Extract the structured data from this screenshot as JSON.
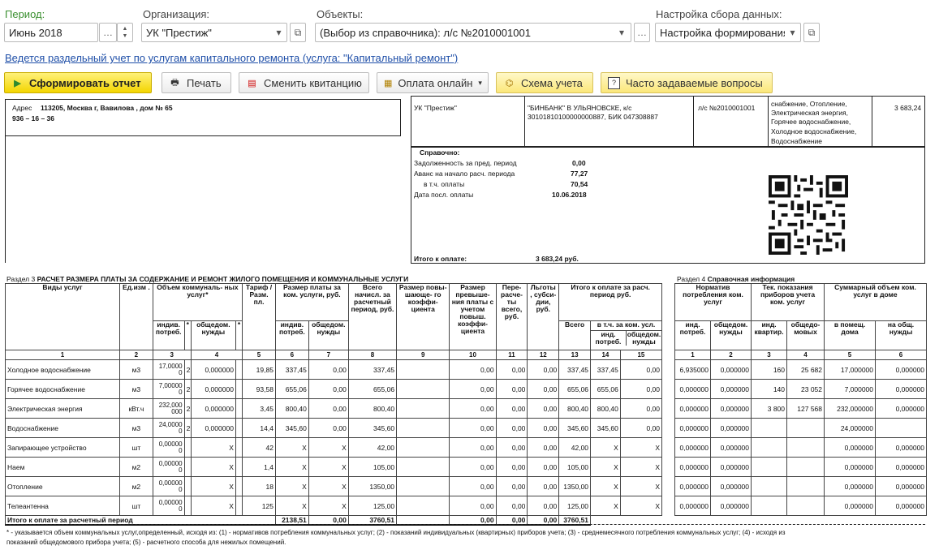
{
  "filters": {
    "period_label": "Период:",
    "period_value": "Июнь 2018",
    "org_label": "Организация:",
    "org_value": "УК \"Престиж\"",
    "objects_label": "Объекты:",
    "objects_value": "(Выбор из справочника): л/с №2010001001",
    "settings_label": "Настройка сбора данных:",
    "settings_value": "Настройка формирования"
  },
  "info_link": "Ведется раздельный учет по услугам капитального ремонта (услуга: \"Капитальный ремонт\")",
  "toolbar": {
    "generate": "Сформировать отчет",
    "print": "Печать",
    "change": "Сменить квитанцию",
    "pay": "Оплата онлайн",
    "scheme": "Схема учета",
    "faq": "Часто задаваемые вопросы"
  },
  "receipt": {
    "addr_label": "Адрес",
    "addr": "113205, Москва г, Вавилова , дом № 65",
    "phone": "936 – 16 – 36",
    "org": "УК \"Престиж\"",
    "bank1": "\"БИНБАНК\" В УЛЬЯНОВСКЕ, к/с",
    "bank2": "30101810100000000887, БИК 047308887",
    "account": "л/с №2010001001",
    "services": [
      "снабжение, Отопление,",
      "Электрическая энергия,",
      "Горячее водоснабжение,",
      "Холодное водоснабжение,",
      "Водоснабжение"
    ],
    "top_amount": "3 683,24",
    "ref_title": "Справочно:",
    "ref_rows": [
      {
        "label": "Задолженность за пред. период",
        "value": "0,00"
      },
      {
        "label": "Аванс на начало расч. периода",
        "value": "77,27"
      },
      {
        "label": "в т.ч. оплаты",
        "value": "70,54"
      },
      {
        "label": "Дата посл. оплаты",
        "value": "10.06.2018"
      }
    ],
    "total_label": "Итого к оплате:",
    "total_value": "3 683,24 руб."
  },
  "section3": {
    "prefix": "Раздел 3",
    "title": "РАСЧЕТ РАЗМЕРА ПЛАТЫ ЗА СОДЕРЖАНИЕ И РЕМОНТ ЖИЛОГО ПОМЕЩЕНИЯ И КОММУНАЛЬНЫЕ УСЛУГИ"
  },
  "section4": {
    "prefix": "Раздел 4",
    "title": "Справочная информация"
  },
  "headers": {
    "services": "Виды услуг",
    "unit": "Ед.изм .",
    "volume": "Объем коммуналь- ных услуг*",
    "indiv": "индив. потреб.",
    "star": "*",
    "common": "общедом. нужды",
    "tariff": "Тариф / Разм. пл.",
    "pay_size": "Размер платы за ком. услуги, руб.",
    "pay_indiv": "индив. потреб.",
    "pay_common": "общедом. нужды",
    "total_charged": "Всего начисл. за расчетный период, руб.",
    "coef": "Размер повы- шающе- го коэффи- циента",
    "excess": "Размер превыше- ния платы с учетом повыш. коэффи- циента",
    "recalc": "Пере- расче- ты всего, руб.",
    "benefits": "Льготы , субси- дии, руб.",
    "topay": "Итого к оплате за расч. период руб.",
    "all": "Всего",
    "incl": "в т.ч. за ком. усл.",
    "incl_indiv": "инд. потреб.",
    "incl_common": "общедом. нужды",
    "norm": "Норматив потребления ком. услуг",
    "norm_ind": "инд. потреб.",
    "norm_common": "общедом. нужды",
    "meters": "Тек. показания приборов учета ком. услуг",
    "meters_ind": "инд. квартир.",
    "meters_common": "общедо- мовых",
    "sum_vol": "Суммарный объем ком. услуг в доме",
    "sum_rooms": "в помещ. дома",
    "sum_common": "на общ. нужды"
  },
  "col_numbers": [
    "1",
    "2",
    "3",
    "4",
    "5",
    "6",
    "7",
    "8",
    "9",
    "10",
    "11",
    "12",
    "13",
    "14",
    "15"
  ],
  "col_numbers_right": [
    "1",
    "2",
    "3",
    "4",
    "5",
    "6"
  ],
  "rows": [
    {
      "name": "Холодное водоснабжение",
      "unit": "м3",
      "vol": "17,0000 0",
      "k": "2",
      "common": "0,000000",
      "tariff": "19,85",
      "p_ind": "337,45",
      "p_com": "0,00",
      "total": "337,45",
      "coef": "",
      "excess": "0,00",
      "recalc": "0,00",
      "benef": "0,00",
      "all": "337,45",
      "i_ind": "337,45",
      "i_com": "0,00",
      "n_ind": "6,935000",
      "n_com": "0,000000",
      "m_ind": "160",
      "m_com": "25 682",
      "s_room": "17,000000",
      "s_com": "0,000000"
    },
    {
      "name": "Горячее водоснабжение",
      "unit": "м3",
      "vol": "7,00000 0",
      "k": "2",
      "common": "0,000000",
      "tariff": "93,58",
      "p_ind": "655,06",
      "p_com": "0,00",
      "total": "655,06",
      "coef": "",
      "excess": "0,00",
      "recalc": "0,00",
      "benef": "0,00",
      "all": "655,06",
      "i_ind": "655,06",
      "i_com": "0,00",
      "n_ind": "0,000000",
      "n_com": "0,000000",
      "m_ind": "140",
      "m_com": "23 052",
      "s_room": "7,000000",
      "s_com": "0,000000"
    },
    {
      "name": "Электрическая энергия",
      "unit": "кВт.ч",
      "vol": "232,000 000",
      "k": "2",
      "common": "0,000000",
      "tariff": "3,45",
      "p_ind": "800,40",
      "p_com": "0,00",
      "total": "800,40",
      "coef": "",
      "excess": "0,00",
      "recalc": "0,00",
      "benef": "0,00",
      "all": "800,40",
      "i_ind": "800,40",
      "i_com": "0,00",
      "n_ind": "0,000000",
      "n_com": "0,000000",
      "m_ind": "3 800",
      "m_com": "127 568",
      "s_room": "232,000000",
      "s_com": "0,000000"
    },
    {
      "name": "Водоснабжение",
      "unit": "м3",
      "vol": "24,0000 0",
      "k": "2",
      "common": "0,000000",
      "tariff": "14,4",
      "p_ind": "345,60",
      "p_com": "0,00",
      "total": "345,60",
      "coef": "",
      "excess": "0,00",
      "recalc": "0,00",
      "benef": "0,00",
      "all": "345,60",
      "i_ind": "345,60",
      "i_com": "0,00",
      "n_ind": "0,000000",
      "n_com": "0,000000",
      "m_ind": "",
      "m_com": "",
      "s_room": "24,000000",
      "s_com": ""
    },
    {
      "name": "Запирающее устройство",
      "unit": "шт",
      "vol": "0,00000 0",
      "k": "",
      "common": "X",
      "tariff": "42",
      "p_ind": "X",
      "p_com": "X",
      "total": "42,00",
      "coef": "",
      "excess": "0,00",
      "recalc": "0,00",
      "benef": "0,00",
      "all": "42,00",
      "i_ind": "X",
      "i_com": "X",
      "n_ind": "0,000000",
      "n_com": "0,000000",
      "m_ind": "",
      "m_com": "",
      "s_room": "0,000000",
      "s_com": "0,000000"
    },
    {
      "name": "Наем",
      "unit": "м2",
      "vol": "0,00000 0",
      "k": "",
      "common": "X",
      "tariff": "1,4",
      "p_ind": "X",
      "p_com": "X",
      "total": "105,00",
      "coef": "",
      "excess": "0,00",
      "recalc": "0,00",
      "benef": "0,00",
      "all": "105,00",
      "i_ind": "X",
      "i_com": "X",
      "n_ind": "0,000000",
      "n_com": "0,000000",
      "m_ind": "",
      "m_com": "",
      "s_room": "0,000000",
      "s_com": "0,000000"
    },
    {
      "name": "Отопление",
      "unit": "м2",
      "vol": "0,00000 0",
      "k": "",
      "common": "X",
      "tariff": "18",
      "p_ind": "X",
      "p_com": "X",
      "total": "1350,00",
      "coef": "",
      "excess": "0,00",
      "recalc": "0,00",
      "benef": "0,00",
      "all": "1350,00",
      "i_ind": "X",
      "i_com": "X",
      "n_ind": "0,000000",
      "n_com": "0,000000",
      "m_ind": "",
      "m_com": "",
      "s_room": "0,000000",
      "s_com": "0,000000"
    },
    {
      "name": "Телеантенна",
      "unit": "шт",
      "vol": "0,00000 0",
      "k": "",
      "common": "X",
      "tariff": "125",
      "p_ind": "X",
      "p_com": "X",
      "total": "125,00",
      "coef": "",
      "excess": "0,00",
      "recalc": "0,00",
      "benef": "0,00",
      "all": "125,00",
      "i_ind": "X",
      "i_com": "X",
      "n_ind": "0,000000",
      "n_com": "0,000000",
      "m_ind": "",
      "m_com": "",
      "s_room": "0,000000",
      "s_com": "0,000000"
    }
  ],
  "totals": {
    "label": "Итого к оплате за расчетный период",
    "p_ind": "2138,51",
    "p_com": "0,00",
    "total": "3760,51",
    "excess": "0,00",
    "recalc": "0,00",
    "benef": "0,00",
    "all": "3760,51"
  },
  "footnote1": "* - указывается объем коммунальных услуг,определенный, исходя из: (1) - нормативов потребления коммунальных услуг; (2) - показаний индивидуальных (квартирных) приборов учета; (3) - среднемесячного потребления коммунальных услуг; (4) - исходя из",
  "footnote2": "показаний общедомового прибора учета; (5) - расчетного способа для нежилых помещений."
}
